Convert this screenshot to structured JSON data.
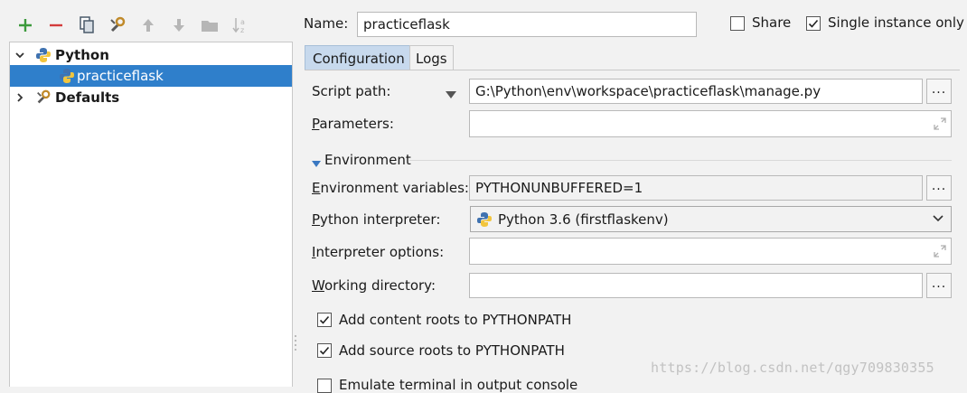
{
  "toolbar": {
    "icons": [
      "add-icon",
      "remove-icon",
      "copy-icon",
      "wrench-icon",
      "move-up-icon",
      "move-down-icon",
      "folder-icon",
      "sort-icon"
    ]
  },
  "tree": {
    "python_label": "Python",
    "child_label": "practiceflask",
    "defaults_label": "Defaults"
  },
  "header": {
    "name_label": "Name:",
    "name_value": "practiceflask",
    "share_label": "Share",
    "share_checked": false,
    "single_instance_label": "Single instance only",
    "single_instance_checked": true
  },
  "tabs": [
    {
      "label": "Configuration",
      "active": true
    },
    {
      "label": "Logs",
      "active": false
    }
  ],
  "form": {
    "script_path_label": "Script path:",
    "script_path_value": "G:\\Python\\env\\workspace\\practiceflask\\manage.py",
    "parameters_label": "Parameters:",
    "parameters_value": "",
    "environment_section": "Environment",
    "env_vars_label": "Environment variables:",
    "env_vars_value": "PYTHONUNBUFFERED=1",
    "interpreter_label": "Python interpreter:",
    "interpreter_value": "Python 3.6 (firstflaskenv)",
    "interp_options_label": "Interpreter options:",
    "interp_options_value": "",
    "working_dir_label": "Working directory:",
    "working_dir_value": "",
    "browse_label": "..."
  },
  "options": {
    "content_roots_label": "Add content roots to PYTHONPATH",
    "content_roots_checked": true,
    "source_roots_label": "Add source roots to PYTHONPATH",
    "source_roots_checked": true,
    "emulate_terminal_label": "Emulate terminal in output console",
    "emulate_terminal_checked": false
  },
  "watermark": "https://blog.csdn.net/qgy709830355",
  "colors": {
    "selection": "#2f7fcb",
    "tab_active": "#c7d9ed",
    "add_green": "#3c9a3c",
    "remove_red": "#d33c3c"
  }
}
